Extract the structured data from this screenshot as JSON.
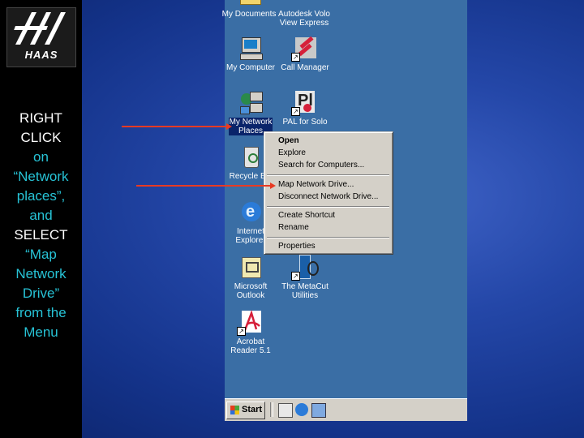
{
  "instruction": {
    "line1": "RIGHT",
    "line2": "CLICK",
    "line3": "on",
    "line4": "“Network",
    "line5": "places”,",
    "line6": "and",
    "line7": "SELECT",
    "line8": "“Map",
    "line9": "Network",
    "line10": "Drive”",
    "line11": "from the",
    "line12": "Menu"
  },
  "logo": {
    "text": "HAAS"
  },
  "desktop_icons": {
    "my_documents": "My Documents",
    "autodesk": "Autodesk Volo\nView Express",
    "my_computer": "My Computer",
    "call_manager": "Call Manager",
    "network_places": "My Network\nPlaces",
    "pal": "PAL for Solo",
    "recycle": "Recycle Bin",
    "ie": "Internet\nExplorer",
    "outlook": "Microsoft\nOutlook",
    "metacut": "The MetaCut\nUtilities",
    "acrobat": "Acrobat\nReader 5.1"
  },
  "context_menu": {
    "open": "Open",
    "explore": "Explore",
    "search": "Search for Computers...",
    "map": "Map Network Drive...",
    "disconnect": "Disconnect Network Drive...",
    "create_shortcut": "Create Shortcut",
    "rename": "Rename",
    "properties": "Properties"
  },
  "taskbar": {
    "start": "Start"
  },
  "colors": {
    "arrow": "#e83a23",
    "desktop": "#3a6ea5",
    "instruction_accent": "#27c3d6"
  }
}
